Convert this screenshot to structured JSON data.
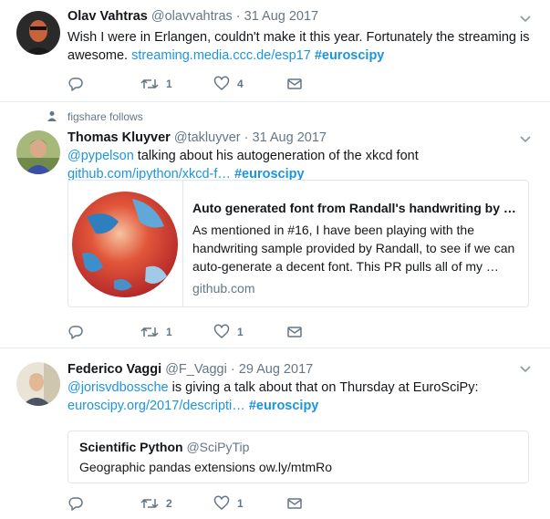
{
  "tweets": [
    {
      "fullname": "Olav Vahtras",
      "screenname": "@olavvahtras",
      "dot": "·",
      "time": "31 Aug 2017",
      "text_plain": "Wish I were in Erlangen, couldn't make it this year. Fortunately the streaming is awesome. ",
      "link": "streaming.media.ccc.de/esp17",
      "hashtag": "#euroscipy",
      "retweets": "1",
      "likes": "4"
    },
    {
      "context": "figshare follows",
      "fullname": "Thomas Kluyver",
      "screenname": "@takluyver",
      "dot": "·",
      "time": "31 Aug 2017",
      "mention": "@pypelson",
      "text_plain": " talking about his autogeneration of the xkcd font",
      "link": "github.com/ipython/xkcd-f…",
      "hashtag": "#euroscipy",
      "card": {
        "title": "Auto generated font from Randall's handwriting by …",
        "description": "As mentioned in #16, I have been playing with the handwriting sample provided by Randall, to see if we can auto-generate a decent font. This PR pulls all of my …",
        "domain": "github.com"
      },
      "retweets": "1",
      "likes": "1"
    },
    {
      "fullname": "Federico Vaggi",
      "screenname": "@F_Vaggi",
      "dot": "·",
      "time": "29 Aug 2017",
      "mention": "@jorisvdbossche",
      "text_plain": " is giving a talk about that on Thursday at EuroSciPy:",
      "link": "euroscipy.org/2017/descripti…",
      "hashtag": "#euroscipy",
      "quote": {
        "fullname": "Scientific Python",
        "screenname": "@SciPyTip",
        "text": "Geographic pandas extensions ow.ly/mtmRo"
      },
      "retweets": "2",
      "likes": "1"
    }
  ],
  "icons": {
    "reply": "reply-icon",
    "retweet": "retweet-icon",
    "like": "heart-icon",
    "dm": "envelope-icon",
    "caret": "chevron-down-icon",
    "follow": "person-icon"
  },
  "colors": {
    "link": "#1b95e0",
    "muted": "#657786",
    "border": "#e6ecf0"
  }
}
